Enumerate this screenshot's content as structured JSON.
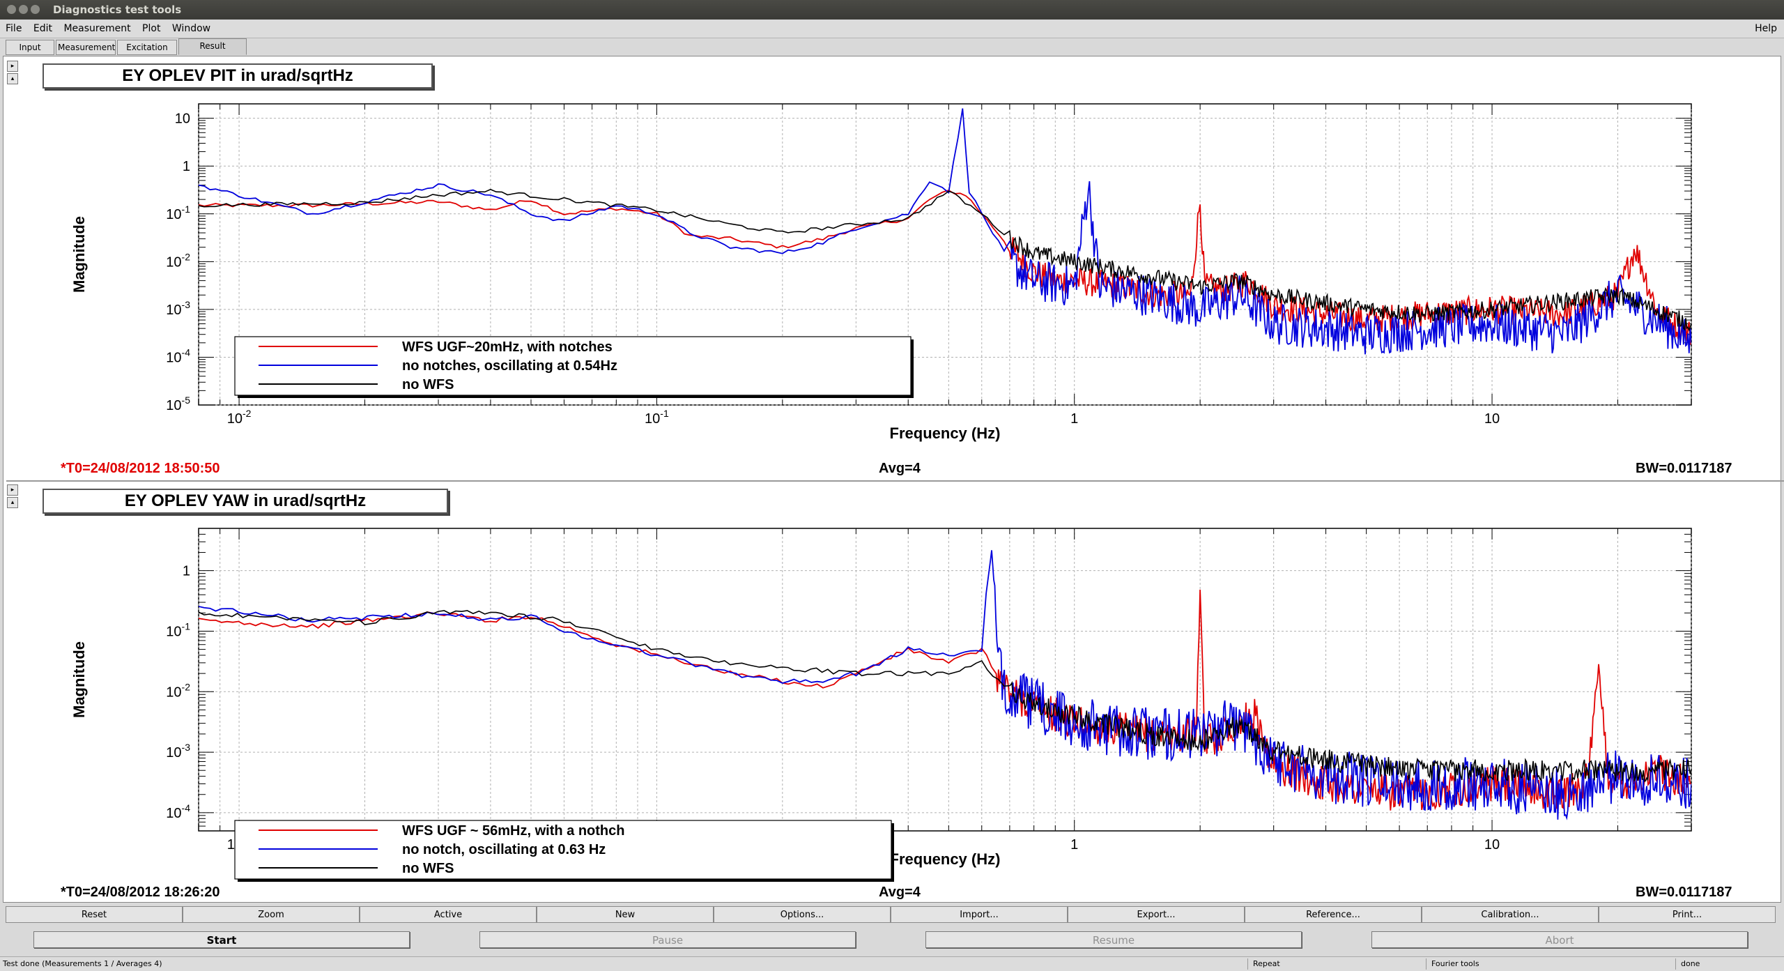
{
  "window": {
    "title": "Diagnostics test tools"
  },
  "menu": {
    "items": [
      "File",
      "Edit",
      "Measurement",
      "Plot",
      "Window"
    ],
    "help": "Help"
  },
  "tabs": [
    "Input",
    "Measurement",
    "Excitation",
    "Result"
  ],
  "active_tab": "Result",
  "colors": {
    "red": "#e00000",
    "blue": "#0000dd",
    "black": "#000000",
    "t0_red": "#e00000"
  },
  "plots": [
    {
      "title": "EY OPLEV PIT in urad/sqrtHz",
      "ylabel": "Magnitude",
      "xlabel": "Frequency (Hz)",
      "t0": "*T0=24/08/2012 18:50:50",
      "t0_red": true,
      "avg": "Avg=4",
      "bw": "BW=0.0117187",
      "legend": [
        {
          "label": "WFS UGF~20mHz, with notches",
          "color": "red"
        },
        {
          "label": "no notches, oscillating at 0.54Hz",
          "color": "blue"
        },
        {
          "label": "no WFS",
          "color": "black"
        }
      ]
    },
    {
      "title": "EY OPLEV YAW in urad/sqrtHz",
      "ylabel": "Magnitude",
      "xlabel": "Frequency (Hz)",
      "t0": "*T0=24/08/2012 18:26:20",
      "t0_red": false,
      "avg": "Avg=4",
      "bw": "BW=0.0117187",
      "legend": [
        {
          "label": "WFS UGF ~ 56mHz, with a nothch",
          "color": "red"
        },
        {
          "label": "no notch, oscillating at 0.63 Hz",
          "color": "blue"
        },
        {
          "label": "no WFS",
          "color": "black"
        }
      ]
    }
  ],
  "chart_data": [
    {
      "type": "line",
      "title": "EY OPLEV PIT in urad/sqrtHz",
      "xlabel": "Frequency (Hz)",
      "ylabel": "Magnitude",
      "xscale": "log",
      "yscale": "log",
      "xlim": [
        0.008,
        30
      ],
      "ylim": [
        1e-05,
        20
      ],
      "xticks": [
        "10^-2",
        "10^-1",
        "1",
        "10"
      ],
      "yticks": [
        "10",
        "1",
        "10^-1",
        "10^-2",
        "10^-3",
        "10^-4",
        "10^-5"
      ],
      "grid": true,
      "legend_position": "bottom-left",
      "series": [
        {
          "name": "WFS UGF~20mHz, with notches",
          "color": "red",
          "x": [
            0.008,
            0.015,
            0.03,
            0.04,
            0.05,
            0.06,
            0.08,
            0.1,
            0.12,
            0.15,
            0.2,
            0.25,
            0.3,
            0.4,
            0.45,
            0.5,
            0.55,
            0.6,
            0.7,
            0.8,
            0.9,
            1.0,
            1.3,
            1.6,
            1.9,
            2.0,
            2.05,
            2.3,
            2.6,
            3.0,
            4.0,
            5.0,
            7.0,
            10,
            15,
            20,
            22,
            25,
            30
          ],
          "y": [
            0.15,
            0.15,
            0.18,
            0.12,
            0.2,
            0.1,
            0.13,
            0.1,
            0.035,
            0.03,
            0.02,
            0.03,
            0.05,
            0.08,
            0.2,
            0.3,
            0.25,
            0.1,
            0.02,
            0.006,
            0.004,
            0.004,
            0.003,
            0.002,
            0.002,
            0.2,
            0.003,
            0.0025,
            0.004,
            0.0012,
            0.0008,
            0.0006,
            0.0008,
            0.001,
            0.0008,
            0.002,
            0.02,
            0.0008,
            0.0003
          ]
        },
        {
          "name": "no notches, oscillating at 0.54Hz",
          "color": "blue",
          "x": [
            0.008,
            0.015,
            0.03,
            0.04,
            0.05,
            0.06,
            0.08,
            0.1,
            0.12,
            0.15,
            0.2,
            0.25,
            0.3,
            0.4,
            0.45,
            0.5,
            0.54,
            0.56,
            0.6,
            0.7,
            0.8,
            1.0,
            1.08,
            1.15,
            1.5,
            2.0,
            2.5,
            3.0,
            4.0,
            5.0,
            7.0,
            10,
            15,
            20,
            30
          ],
          "y": [
            0.4,
            0.1,
            0.4,
            0.25,
            0.1,
            0.07,
            0.15,
            0.1,
            0.04,
            0.02,
            0.015,
            0.025,
            0.05,
            0.1,
            0.5,
            0.3,
            15,
            0.3,
            0.1,
            0.01,
            0.004,
            0.003,
            0.4,
            0.003,
            0.002,
            0.001,
            0.002,
            0.0005,
            0.0004,
            0.0003,
            0.0004,
            0.0005,
            0.0003,
            0.002,
            0.0002
          ]
        },
        {
          "name": "no WFS",
          "color": "black",
          "x": [
            0.008,
            0.02,
            0.03,
            0.04,
            0.06,
            0.08,
            0.1,
            0.15,
            0.2,
            0.3,
            0.4,
            0.5,
            0.6,
            0.7,
            0.8,
            1.0,
            1.5,
            2.0,
            2.5,
            3.0,
            5.0,
            7.0,
            10,
            20,
            30
          ],
          "y": [
            0.15,
            0.17,
            0.25,
            0.3,
            0.2,
            0.15,
            0.12,
            0.06,
            0.04,
            0.06,
            0.08,
            0.3,
            0.1,
            0.03,
            0.015,
            0.01,
            0.005,
            0.003,
            0.004,
            0.002,
            0.001,
            0.0008,
            0.001,
            0.002,
            0.0005
          ]
        }
      ]
    },
    {
      "type": "line",
      "title": "EY OPLEV YAW in urad/sqrtHz",
      "xlabel": "Frequency (Hz)",
      "ylabel": "Magnitude",
      "xscale": "log",
      "yscale": "log",
      "xlim": [
        0.008,
        30
      ],
      "ylim": [
        5e-05,
        5
      ],
      "xticks": [
        "10^-2",
        "10^-1",
        "1",
        "10"
      ],
      "yticks": [
        "1",
        "10^-1",
        "10^-2",
        "10^-3",
        "10^-4"
      ],
      "grid": true,
      "legend_position": "bottom-left",
      "series": [
        {
          "name": "WFS UGF ~ 56mHz, with a nothch",
          "color": "red",
          "x": [
            0.008,
            0.015,
            0.03,
            0.04,
            0.05,
            0.06,
            0.08,
            0.1,
            0.12,
            0.15,
            0.2,
            0.25,
            0.3,
            0.4,
            0.5,
            0.6,
            0.65,
            0.7,
            0.8,
            1.0,
            1.5,
            1.95,
            2.0,
            2.05,
            2.5,
            2.7,
            3.0,
            4.0,
            6.0,
            10,
            15,
            17,
            18,
            19,
            20,
            25,
            30
          ],
          "y": [
            0.15,
            0.12,
            0.2,
            0.15,
            0.18,
            0.12,
            0.06,
            0.04,
            0.03,
            0.02,
            0.015,
            0.012,
            0.02,
            0.05,
            0.03,
            0.05,
            0.02,
            0.01,
            0.006,
            0.003,
            0.002,
            0.002,
            0.25,
            0.0015,
            0.003,
            0.004,
            0.0006,
            0.0003,
            0.0002,
            0.0003,
            0.0002,
            0.0004,
            0.02,
            0.0004,
            0.0003,
            0.0005,
            0.0003
          ]
        },
        {
          "name": "no notch, oscillating at 0.63 Hz",
          "color": "blue",
          "x": [
            0.008,
            0.015,
            0.03,
            0.04,
            0.05,
            0.06,
            0.08,
            0.1,
            0.12,
            0.15,
            0.2,
            0.25,
            0.3,
            0.4,
            0.5,
            0.6,
            0.63,
            0.66,
            0.7,
            0.8,
            1.0,
            1.5,
            2.0,
            2.5,
            3.0,
            4.0,
            6.0,
            10,
            15,
            20,
            30
          ],
          "y": [
            0.25,
            0.15,
            0.2,
            0.15,
            0.18,
            0.1,
            0.06,
            0.04,
            0.03,
            0.02,
            0.015,
            0.015,
            0.02,
            0.05,
            0.04,
            0.05,
            3,
            0.02,
            0.01,
            0.006,
            0.003,
            0.002,
            0.002,
            0.003,
            0.0008,
            0.0004,
            0.0003,
            0.0003,
            0.0002,
            0.0004,
            0.0003
          ]
        },
        {
          "name": "no WFS",
          "color": "black",
          "x": [
            0.008,
            0.02,
            0.03,
            0.04,
            0.06,
            0.08,
            0.1,
            0.15,
            0.2,
            0.3,
            0.4,
            0.5,
            0.6,
            0.7,
            0.8,
            1.0,
            1.5,
            2.0,
            2.5,
            3.0,
            5.0,
            7.0,
            10,
            20,
            30
          ],
          "y": [
            0.2,
            0.14,
            0.2,
            0.2,
            0.15,
            0.08,
            0.05,
            0.03,
            0.025,
            0.02,
            0.02,
            0.02,
            0.03,
            0.01,
            0.006,
            0.004,
            0.002,
            0.0015,
            0.003,
            0.001,
            0.0006,
            0.0005,
            0.0005,
            0.0005,
            0.0005
          ]
        }
      ]
    }
  ],
  "toolbar": [
    "Reset",
    "Zoom",
    "Active",
    "New",
    "Options...",
    "Import...",
    "Export...",
    "Reference...",
    "Calibration...",
    "Print..."
  ],
  "actions": [
    {
      "label": "Start",
      "enabled": true
    },
    {
      "label": "Pause",
      "enabled": false
    },
    {
      "label": "Resume",
      "enabled": false
    },
    {
      "label": "Abort",
      "enabled": false
    }
  ],
  "status": {
    "left": "Test done (Measurements 1 / Averages 4)",
    "repeat": "Repeat",
    "fourier": "Fourier tools",
    "done": "done"
  }
}
